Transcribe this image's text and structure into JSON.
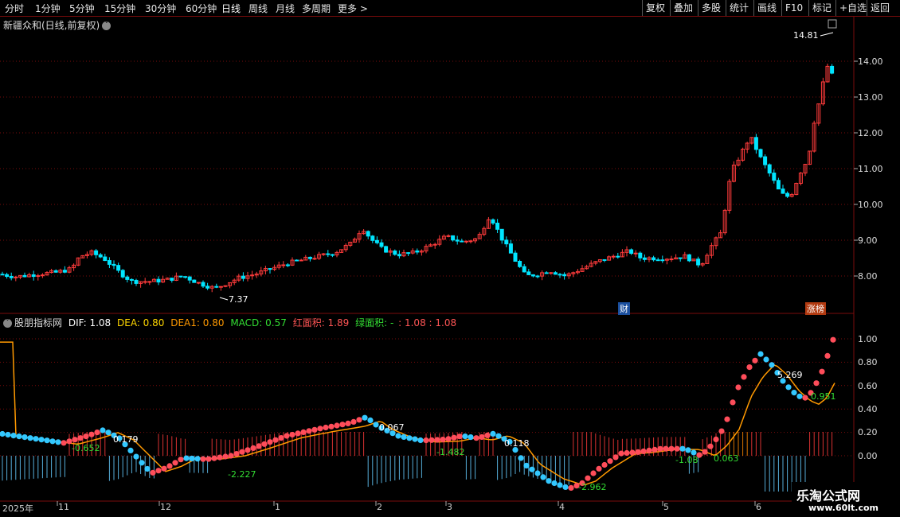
{
  "toolbar": {
    "periods": [
      "分时",
      "1分钟",
      "5分钟",
      "15分钟",
      "30分钟",
      "60分钟",
      "日线",
      "周线",
      "月线",
      "多周期",
      "更多 >"
    ],
    "active_period": "日线",
    "right_buttons": [
      "复权",
      "叠加",
      "多股",
      "统计",
      "画线",
      "F10",
      "标记",
      "+自选",
      "返回"
    ]
  },
  "main_pane": {
    "title": "新疆众和(日线,前复权)",
    "high_marker": "14.81",
    "low_marker": "7.37",
    "event_cai": "财",
    "event_zhangbang": "涨榜",
    "price_axis": [
      "14.00",
      "13.00",
      "12.00",
      "11.00",
      "10.00",
      "9.00",
      "8.00"
    ]
  },
  "indicator_pane": {
    "name": "股朋指标网",
    "dif_label": "DIF: 1.08",
    "dea_label": "DEA: 0.80",
    "dea1_label": "DEA1: 0.80",
    "macd_label": "MACD: 0.57",
    "red_area_label": "红面积: 1.89",
    "green_area_label": "绿面积: -",
    "tail_label": ": 1.08 : 1.08",
    "axis": [
      "1.00",
      "0.80",
      "0.60",
      "0.40",
      "0.20",
      "0.00"
    ],
    "annotations": [
      "-0.652",
      "0.179",
      "-2.227",
      "0.067",
      "-1.482",
      "0.118",
      "-2.962",
      "-1.08",
      "0.063",
      "5.269",
      "0.951"
    ]
  },
  "date_axis": [
    "2025年",
    "11",
    "12",
    "1",
    "2",
    "3",
    "4",
    "5",
    "6"
  ],
  "watermark": {
    "title": "乐淘公式网",
    "url": "www.60lt.com"
  },
  "colors": {
    "up": "#ff3b3b",
    "down": "#00e5ff",
    "dea_line": "#ff9900",
    "grid": "#7a0b0b"
  }
}
